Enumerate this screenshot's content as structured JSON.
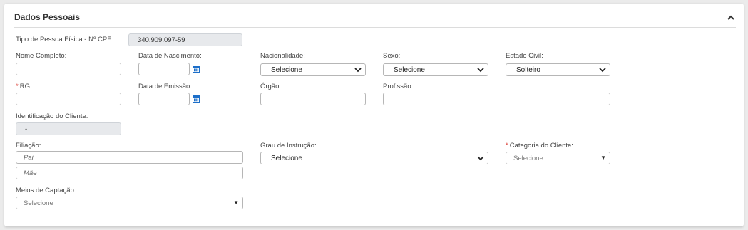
{
  "section": {
    "title": "Dados Pessoais",
    "collapse_icon": "chevron-up-icon"
  },
  "cpf": {
    "label": "Tipo de Pessoa Física - Nº CPF:",
    "value": "340.909.097-59"
  },
  "nome": {
    "label": "Nome Completo:",
    "value": ""
  },
  "nascimento": {
    "label": "Data de Nascimento:",
    "value": "",
    "icon": "calendar-icon"
  },
  "nacionalidade": {
    "label": "Nacionalidade:",
    "selected": "Selecione"
  },
  "sexo": {
    "label": "Sexo:",
    "selected": "Selecione"
  },
  "estado_civil": {
    "label": "Estado Civil:",
    "selected": "Solteiro"
  },
  "rg": {
    "required_mark": "*",
    "label": "RG:",
    "value": ""
  },
  "emissao": {
    "label": "Data de Emissão:",
    "value": "",
    "icon": "calendar-icon"
  },
  "orgao": {
    "label": "Órgão:",
    "value": ""
  },
  "profissao": {
    "label": "Profissão:",
    "value": ""
  },
  "identificacao": {
    "label": "Identificação do Cliente:",
    "value": "-"
  },
  "filiacao": {
    "label": "Filiação:",
    "pai_placeholder": "Pai",
    "mae_placeholder": "Mãe"
  },
  "grau": {
    "label": "Grau de Instrução:",
    "selected": "Selecione"
  },
  "categoria": {
    "required_mark": "*",
    "label": "Categoria do Cliente:",
    "selected": "Selecione"
  },
  "meios": {
    "label": "Meios de Captação:",
    "selected": "Selecione"
  },
  "colors": {
    "accent": "#1d6fc9",
    "required": "#d9342b",
    "readonly_bg": "#e7e9ec"
  }
}
